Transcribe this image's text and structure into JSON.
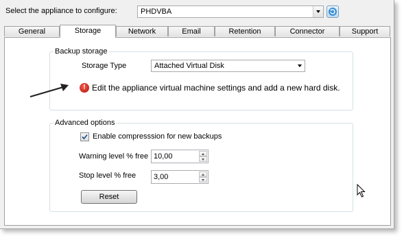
{
  "header": {
    "select_label": "Select the appliance to configure:",
    "appliance_value": "PHDVBA"
  },
  "tabs": [
    {
      "label": "General",
      "active": false
    },
    {
      "label": "Storage",
      "active": true
    },
    {
      "label": "Network",
      "active": false
    },
    {
      "label": "Email",
      "active": false
    },
    {
      "label": "Retention",
      "active": false
    },
    {
      "label": "Connector",
      "active": false
    },
    {
      "label": "Support",
      "active": false
    }
  ],
  "backup_storage": {
    "title": "Backup storage",
    "storage_type_label": "Storage Type",
    "storage_type_value": "Attached Virtual Disk",
    "error_message": "Edit the appliance virtual machine settings and add a new hard disk."
  },
  "advanced": {
    "title": "Advanced options",
    "compression_label": "Enable compresssion for new backups",
    "compression_checked": true,
    "warning_label": "Warning level % free",
    "warning_value": "10,00",
    "stop_label": "Stop level % free",
    "stop_value": "3,00",
    "reset_label": "Reset"
  },
  "colors": {
    "error_icon": "#c8190e",
    "refresh_button": "#3b8fd6",
    "annotation_arrow": "#222222"
  }
}
